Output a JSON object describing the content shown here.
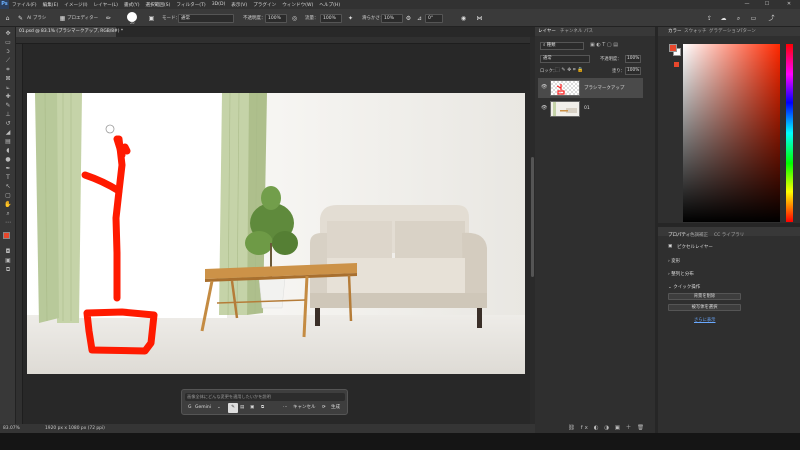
{
  "app": {
    "logo": "Ps",
    "menu": [
      "ファイル(F)",
      "編集(E)",
      "イメージ(I)",
      "レイヤー(L)",
      "書式(Y)",
      "選択範囲(S)",
      "フィルター(T)",
      "3D(D)",
      "表示(V)",
      "プラグイン",
      "ウィンドウ(W)",
      "ヘルプ(H)"
    ],
    "window_controls": [
      "—",
      "☐",
      "✕"
    ]
  },
  "options": {
    "brush_tool_label": "AI ブラシ",
    "preset_label": "プロエディター",
    "brush_size": "20",
    "mode_label": "モード：",
    "mode_value": "通常",
    "opacity_label": "不透明度：",
    "opacity_value": "100%",
    "flow_label": "流量：",
    "flow_value": "100%",
    "smoothing_label": "滑らかさ：",
    "smoothing_value": "10%",
    "angle_value": "0°"
  },
  "document": {
    "tab_title": "01.psd @ 83.1% (ブラシマークアップ, RGB/8#) *",
    "zoom": "83.07%",
    "size": "1920 px x 1080 px (72 ppi)"
  },
  "generative_bar": {
    "placeholder": "画像全体にどんな変更を適用したいかを説明",
    "model": "Gemini",
    "cancel": "キャンセル",
    "generate": "生成"
  },
  "layers_panel": {
    "tabs": [
      "レイヤー",
      "チャンネル",
      "パス"
    ],
    "filter_kind": "種類",
    "blend_mode": "通常",
    "opacity_label": "不透明度：",
    "opacity_value": "100%",
    "lock_label": "ロック：",
    "fill_label": "塗り：",
    "fill_value": "100%",
    "layers": [
      {
        "name": "ブラシマークアップ",
        "selected": true
      },
      {
        "name": "01",
        "selected": false
      }
    ]
  },
  "color_panel": {
    "tabs": [
      "カラー",
      "スウォッチ",
      "グラデーション",
      "パターン"
    ],
    "foreground": "#e8472c",
    "background": "#ffffff"
  },
  "properties_panel": {
    "tabs": [
      "プロパティ",
      "色調補正",
      "CC ライブラリ"
    ],
    "layer_type": "ピクセルレイヤー",
    "sections": [
      "変形",
      "整列と分布",
      "クイック操作"
    ],
    "buttons": [
      "背景を削除",
      "被写体を選択"
    ],
    "more_link": "さらに表示"
  }
}
